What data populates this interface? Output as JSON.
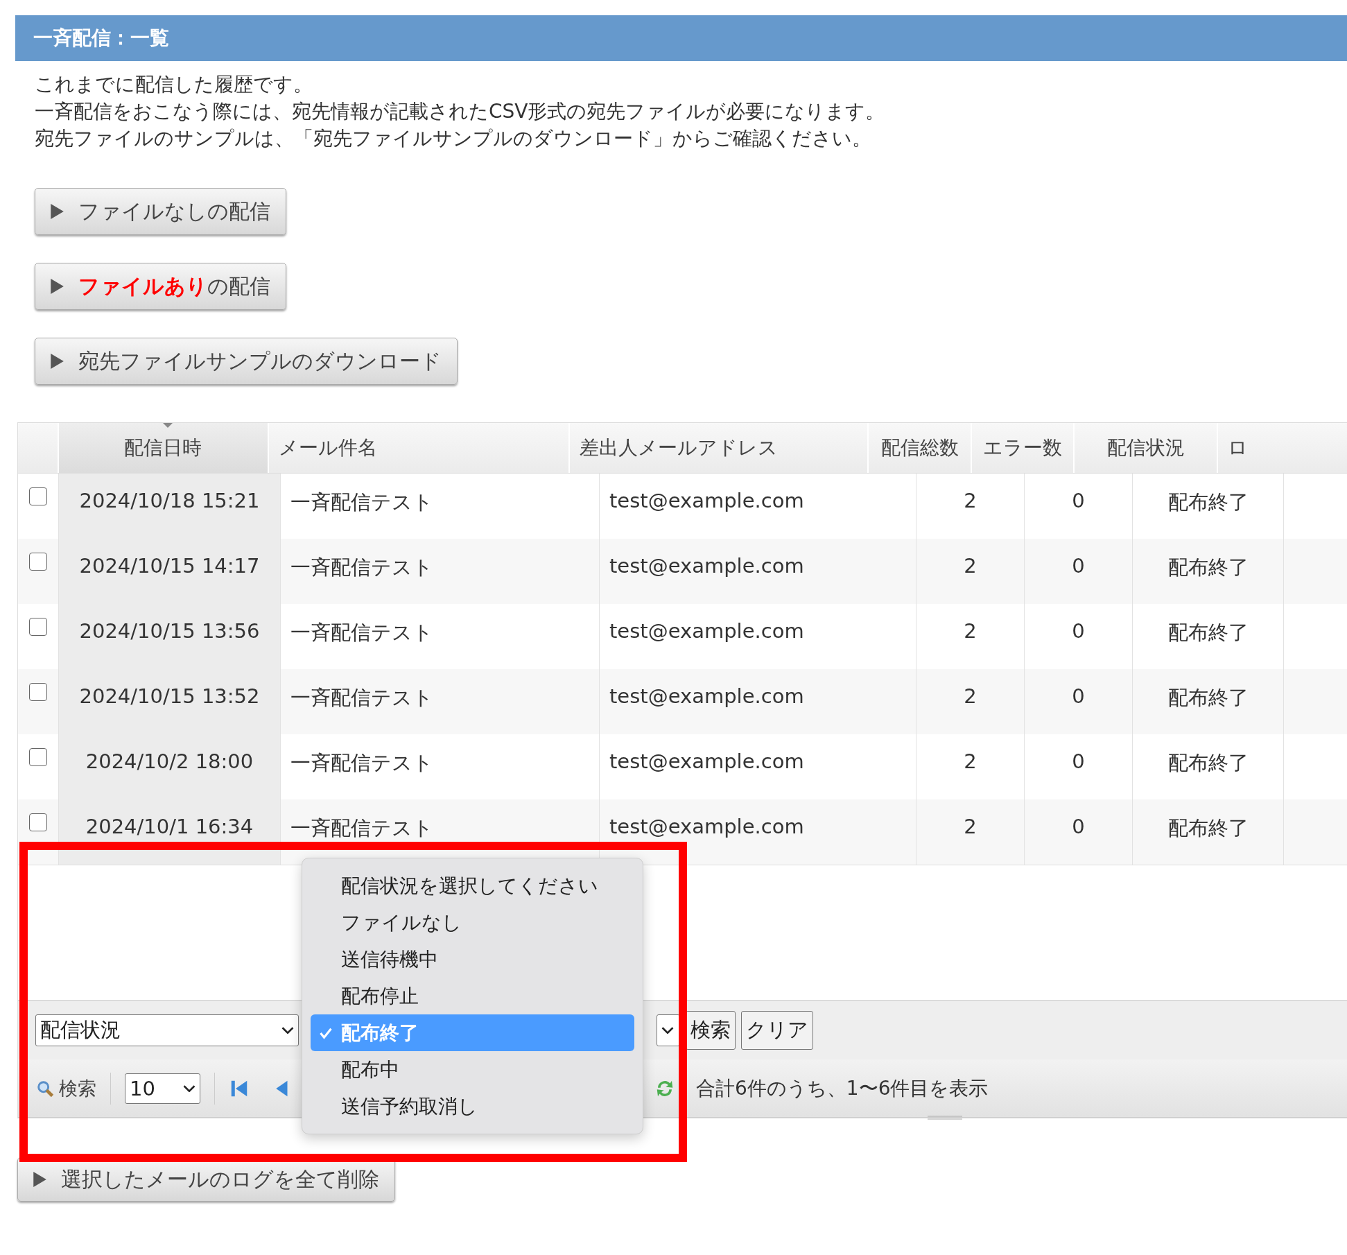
{
  "header": {
    "title": "一斉配信：一覧"
  },
  "description": [
    "これまでに配信した履歴です。",
    "一斉配信をおこなう際には、宛先情報が記載されたCSV形式の宛先ファイルが必要になります。",
    "宛先ファイルのサンプルは、「宛先ファイルサンプルのダウンロード」からご確認ください。"
  ],
  "actions": [
    {
      "label": "ファイルなしの配信"
    },
    {
      "label": "**ファイルあり**の配信"
    },
    {
      "label": "宛先ファイルサンプルのダウンロード"
    }
  ],
  "table": {
    "columns": [
      {
        "label": "配信日時",
        "sorted": true
      },
      {
        "label": "メール件名",
        "sorted": false
      },
      {
        "label": "差出人メールアドレス",
        "sorted": false
      },
      {
        "label": "配信総数",
        "sorted": false
      },
      {
        "label": "エラー数",
        "sorted": false
      },
      {
        "label": "配信状況",
        "sorted": false
      },
      {
        "label": "ロ",
        "sorted": false
      }
    ],
    "rows": [
      {
        "checked": false,
        "cells": [
          "2024/10/18 15:21",
          "一斉配信テスト",
          "test@example.com",
          "2",
          "0",
          "配布終了"
        ]
      },
      {
        "checked": false,
        "cells": [
          "2024/10/15 14:17",
          "一斉配信テスト",
          "test@example.com",
          "2",
          "0",
          "配布終了"
        ]
      },
      {
        "checked": false,
        "cells": [
          "2024/10/15 13:56",
          "一斉配信テスト",
          "test@example.com",
          "2",
          "0",
          "配布終了"
        ]
      },
      {
        "checked": false,
        "cells": [
          "2024/10/15 13:52",
          "一斉配信テスト",
          "test@example.com",
          "2",
          "0",
          "配布終了"
        ]
      },
      {
        "checked": false,
        "cells": [
          "2024/10/2 18:00",
          "一斉配信テスト",
          "test@example.com",
          "2",
          "0",
          "配布終了"
        ]
      },
      {
        "checked": false,
        "cells": [
          "2024/10/1 16:34",
          "一斉配信テスト",
          "test@example.com",
          "2",
          "0",
          "配布終了"
        ]
      }
    ]
  },
  "filter": {
    "status_select": {
      "value": "配信状況"
    },
    "buttons": [
      "検索",
      "クリア"
    ]
  },
  "pager": {
    "search_label": "検索",
    "page_size": "10",
    "summary": "合計6件のうち、1〜6件目を表示"
  },
  "status_menu": {
    "options": [
      {
        "label": "配信状況を選択してください",
        "selected": false
      },
      {
        "label": "ファイルなし",
        "selected": false
      },
      {
        "label": "送信待機中",
        "selected": false
      },
      {
        "label": "配布停止",
        "selected": false
      },
      {
        "label": "配布終了",
        "selected": true
      },
      {
        "label": "配布中",
        "selected": false
      },
      {
        "label": "送信予約取消し",
        "selected": false
      }
    ]
  },
  "bottom_actions": [
    {
      "label": "選択したメールのログを全て削除"
    }
  ]
}
